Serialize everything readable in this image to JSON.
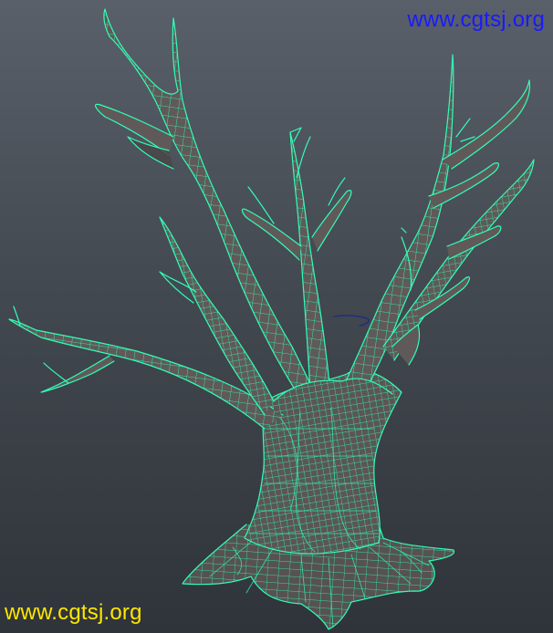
{
  "viewport": {
    "background_top": "#59606a",
    "background_bottom": "#2f343a",
    "wireframe_color": "#30ffb8",
    "mesh_fill_color": "#5f5a59",
    "nurbs_curve_color": "#1a2b8a"
  },
  "watermarks": {
    "top": {
      "text": "www.cgtsj.org",
      "color": "#1a1aff"
    },
    "bottom": {
      "text": "www.cgtsj.org",
      "color": "#ffe600"
    }
  }
}
